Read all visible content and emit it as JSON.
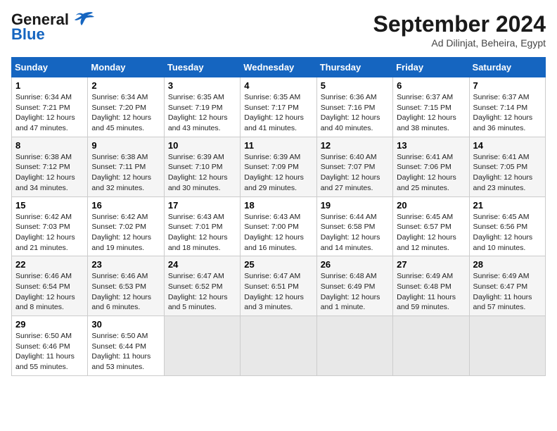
{
  "header": {
    "logo_general": "General",
    "logo_blue": "Blue",
    "month_title": "September 2024",
    "subtitle": "Ad Dilinjat, Beheira, Egypt"
  },
  "days_of_week": [
    "Sunday",
    "Monday",
    "Tuesday",
    "Wednesday",
    "Thursday",
    "Friday",
    "Saturday"
  ],
  "weeks": [
    [
      {
        "day": "1",
        "sunrise": "6:34 AM",
        "sunset": "7:21 PM",
        "daylight": "12 hours and 47 minutes."
      },
      {
        "day": "2",
        "sunrise": "6:34 AM",
        "sunset": "7:20 PM",
        "daylight": "12 hours and 45 minutes."
      },
      {
        "day": "3",
        "sunrise": "6:35 AM",
        "sunset": "7:19 PM",
        "daylight": "12 hours and 43 minutes."
      },
      {
        "day": "4",
        "sunrise": "6:35 AM",
        "sunset": "7:17 PM",
        "daylight": "12 hours and 41 minutes."
      },
      {
        "day": "5",
        "sunrise": "6:36 AM",
        "sunset": "7:16 PM",
        "daylight": "12 hours and 40 minutes."
      },
      {
        "day": "6",
        "sunrise": "6:37 AM",
        "sunset": "7:15 PM",
        "daylight": "12 hours and 38 minutes."
      },
      {
        "day": "7",
        "sunrise": "6:37 AM",
        "sunset": "7:14 PM",
        "daylight": "12 hours and 36 minutes."
      }
    ],
    [
      {
        "day": "8",
        "sunrise": "6:38 AM",
        "sunset": "7:12 PM",
        "daylight": "12 hours and 34 minutes."
      },
      {
        "day": "9",
        "sunrise": "6:38 AM",
        "sunset": "7:11 PM",
        "daylight": "12 hours and 32 minutes."
      },
      {
        "day": "10",
        "sunrise": "6:39 AM",
        "sunset": "7:10 PM",
        "daylight": "12 hours and 30 minutes."
      },
      {
        "day": "11",
        "sunrise": "6:39 AM",
        "sunset": "7:09 PM",
        "daylight": "12 hours and 29 minutes."
      },
      {
        "day": "12",
        "sunrise": "6:40 AM",
        "sunset": "7:07 PM",
        "daylight": "12 hours and 27 minutes."
      },
      {
        "day": "13",
        "sunrise": "6:41 AM",
        "sunset": "7:06 PM",
        "daylight": "12 hours and 25 minutes."
      },
      {
        "day": "14",
        "sunrise": "6:41 AM",
        "sunset": "7:05 PM",
        "daylight": "12 hours and 23 minutes."
      }
    ],
    [
      {
        "day": "15",
        "sunrise": "6:42 AM",
        "sunset": "7:03 PM",
        "daylight": "12 hours and 21 minutes."
      },
      {
        "day": "16",
        "sunrise": "6:42 AM",
        "sunset": "7:02 PM",
        "daylight": "12 hours and 19 minutes."
      },
      {
        "day": "17",
        "sunrise": "6:43 AM",
        "sunset": "7:01 PM",
        "daylight": "12 hours and 18 minutes."
      },
      {
        "day": "18",
        "sunrise": "6:43 AM",
        "sunset": "7:00 PM",
        "daylight": "12 hours and 16 minutes."
      },
      {
        "day": "19",
        "sunrise": "6:44 AM",
        "sunset": "6:58 PM",
        "daylight": "12 hours and 14 minutes."
      },
      {
        "day": "20",
        "sunrise": "6:45 AM",
        "sunset": "6:57 PM",
        "daylight": "12 hours and 12 minutes."
      },
      {
        "day": "21",
        "sunrise": "6:45 AM",
        "sunset": "6:56 PM",
        "daylight": "12 hours and 10 minutes."
      }
    ],
    [
      {
        "day": "22",
        "sunrise": "6:46 AM",
        "sunset": "6:54 PM",
        "daylight": "12 hours and 8 minutes."
      },
      {
        "day": "23",
        "sunrise": "6:46 AM",
        "sunset": "6:53 PM",
        "daylight": "12 hours and 6 minutes."
      },
      {
        "day": "24",
        "sunrise": "6:47 AM",
        "sunset": "6:52 PM",
        "daylight": "12 hours and 5 minutes."
      },
      {
        "day": "25",
        "sunrise": "6:47 AM",
        "sunset": "6:51 PM",
        "daylight": "12 hours and 3 minutes."
      },
      {
        "day": "26",
        "sunrise": "6:48 AM",
        "sunset": "6:49 PM",
        "daylight": "12 hours and 1 minute."
      },
      {
        "day": "27",
        "sunrise": "6:49 AM",
        "sunset": "6:48 PM",
        "daylight": "11 hours and 59 minutes."
      },
      {
        "day": "28",
        "sunrise": "6:49 AM",
        "sunset": "6:47 PM",
        "daylight": "11 hours and 57 minutes."
      }
    ],
    [
      {
        "day": "29",
        "sunrise": "6:50 AM",
        "sunset": "6:46 PM",
        "daylight": "11 hours and 55 minutes."
      },
      {
        "day": "30",
        "sunrise": "6:50 AM",
        "sunset": "6:44 PM",
        "daylight": "11 hours and 53 minutes."
      },
      null,
      null,
      null,
      null,
      null
    ]
  ],
  "labels": {
    "sunrise": "Sunrise:",
    "sunset": "Sunset:",
    "daylight": "Daylight:"
  }
}
